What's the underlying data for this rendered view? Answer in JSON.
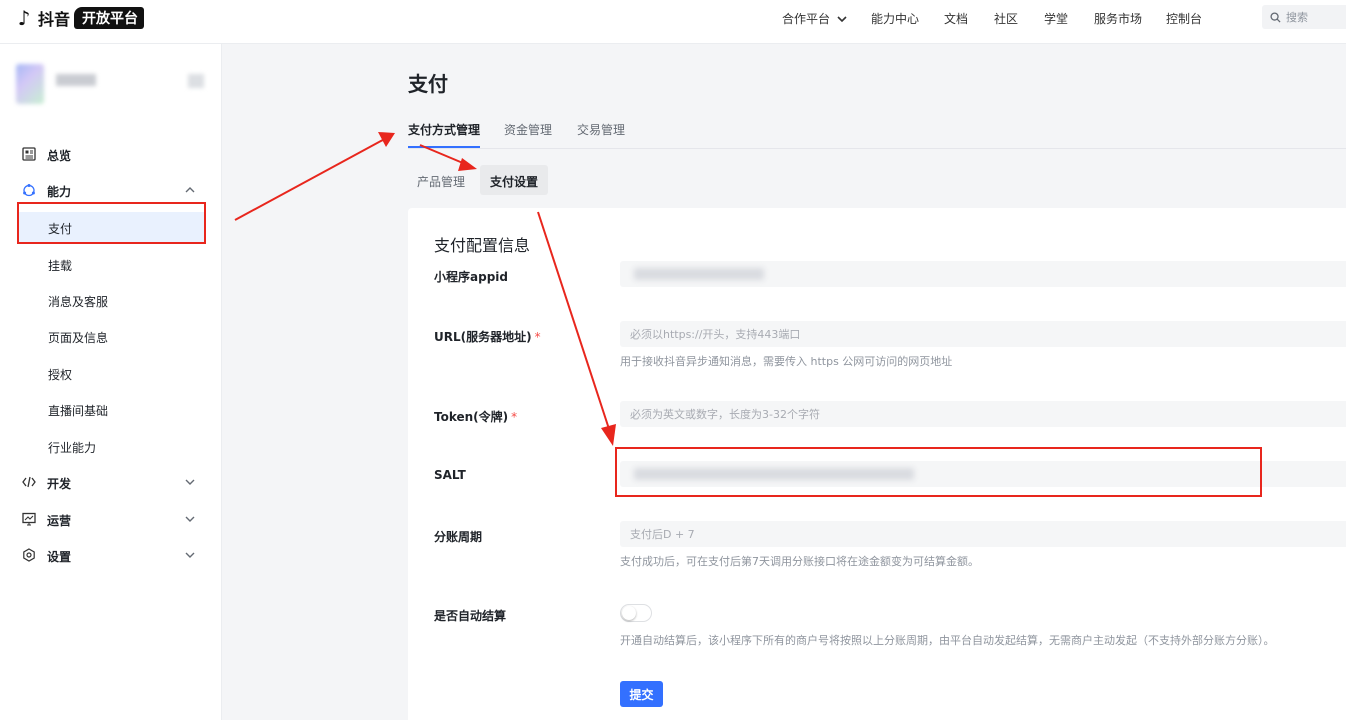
{
  "topbar": {
    "logo_text": "抖音",
    "logo_badge": "开放平台",
    "nav": [
      "合作平台",
      "能力中心",
      "文档",
      "社区",
      "学堂",
      "服务市场",
      "控制台"
    ],
    "search_placeholder": "搜索"
  },
  "sidebar": {
    "overview": "总览",
    "ability": "能力",
    "ability_items": [
      "支付",
      "挂载",
      "消息及客服",
      "页面及信息",
      "授权",
      "直播间基础",
      "行业能力"
    ],
    "develop": "开发",
    "operate": "运营",
    "settings": "设置"
  },
  "main": {
    "title": "支付",
    "tabs": [
      "支付方式管理",
      "资金管理",
      "交易管理"
    ],
    "subtabs": [
      "产品管理",
      "支付设置"
    ]
  },
  "form": {
    "title": "支付配置信息",
    "appid_label": "小程序appid",
    "url_label": "URL(服务器地址)",
    "url_placeholder": "必须以https://开头，支持443端口",
    "url_hint": "用于接收抖音异步通知消息，需要传入 https 公网可访问的网页地址",
    "token_label": "Token(令牌)",
    "token_placeholder": "必须为英文或数字，长度为3-32个字符",
    "salt_label": "SALT",
    "period_label": "分账周期",
    "period_placeholder": "支付后D + 7",
    "period_hint": "支付成功后，可在支付后第7天调用分账接口将在途金额变为可结算金额。",
    "auto_label": "是否自动结算",
    "auto_hint": "开通自动结算后，该小程序下所有的商户号将按照以上分账周期，由平台自动发起结算，无需商户主动发起（不支持外部分账方分账）。",
    "required_mark": "*",
    "submit": "提交"
  },
  "colors": {
    "accent": "#3370ff",
    "annotation": "#e8261d",
    "active_bg": "#e9f1fe"
  }
}
